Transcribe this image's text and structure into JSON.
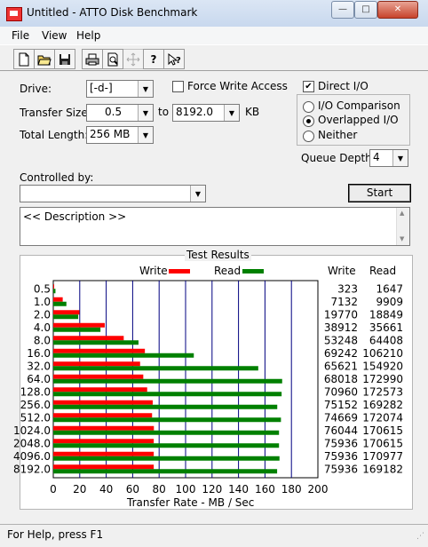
{
  "window": {
    "title": "Untitled - ATTO Disk Benchmark"
  },
  "title_buttons": {
    "minimize": "—",
    "maximize": "□",
    "close": "✕"
  },
  "menu": {
    "file": "File",
    "view": "View",
    "help": "Help"
  },
  "toolbar": {
    "icons": [
      "new-document-icon",
      "open-folder-icon",
      "save-disk-icon",
      "print-icon",
      "print-preview-icon",
      "move-icon",
      "help-question-icon",
      "context-help-icon"
    ]
  },
  "form": {
    "drive_label": "Drive:",
    "drive_value": "[-d-]",
    "force_write_label": "Force Write Access",
    "direct_io_label": "Direct I/O",
    "direct_io_checked": true,
    "transfer_size_label": "Transfer Size:",
    "transfer_from": "0.5",
    "to_label": "to",
    "transfer_to": "8192.0",
    "kb_label": "KB",
    "total_length_label": "Total Length:",
    "total_length_value": "256 MB",
    "io_comparison_label": "I/O Comparison",
    "overlapped_io_label": "Overlapped I/O",
    "neither_label": "Neither",
    "selected_io_mode": "overlapped",
    "queue_depth_label": "Queue Depth:",
    "queue_depth_value": "4",
    "controlled_by_label": "Controlled by:",
    "controlled_by_value": "",
    "start_label": "Start",
    "description_text": "<< Description >>"
  },
  "results": {
    "title": "Test Results",
    "legend_write": "Write",
    "legend_read": "Read",
    "col_write": "Write",
    "col_read": "Read"
  },
  "colors": {
    "write": "#ff0000",
    "read": "#008000",
    "grid": "#000080"
  },
  "chart_data": {
    "type": "bar",
    "orientation": "horizontal",
    "categories": [
      "0.5",
      "1.0",
      "2.0",
      "4.0",
      "8.0",
      "16.0",
      "32.0",
      "64.0",
      "128.0",
      "256.0",
      "512.0",
      "1024.0",
      "2048.0",
      "4096.0",
      "8192.0"
    ],
    "series": [
      {
        "name": "Write",
        "values": [
          323,
          7132,
          19770,
          38912,
          53248,
          69242,
          65621,
          68018,
          70960,
          75152,
          74669,
          76044,
          75936,
          75936,
          75936
        ]
      },
      {
        "name": "Read",
        "values": [
          1647,
          9909,
          18849,
          35661,
          64408,
          106210,
          154920,
          172990,
          172573,
          169282,
          172074,
          170615,
          170615,
          170977,
          169182
        ]
      }
    ],
    "write_labels": [
      "323",
      "7132",
      "19770",
      "38912",
      "53248",
      "69242",
      "65621",
      "68018",
      "70960",
      "75152",
      "74669",
      "76044",
      "75936",
      "75936",
      "75936"
    ],
    "read_labels": [
      "1647",
      "9909",
      "18849",
      "35661",
      "64408",
      "106210",
      "154920",
      "172990",
      "172573",
      "169282",
      "172074",
      "170615",
      "170615",
      "170977",
      "169182"
    ],
    "xlabel": "Transfer Rate - MB / Sec",
    "xlim": [
      0,
      200
    ],
    "xticks": [
      "0",
      "20",
      "40",
      "60",
      "80",
      "100",
      "120",
      "140",
      "160",
      "180",
      "200"
    ],
    "grid": true,
    "legend": "top"
  },
  "status": {
    "text": "For Help, press F1"
  }
}
